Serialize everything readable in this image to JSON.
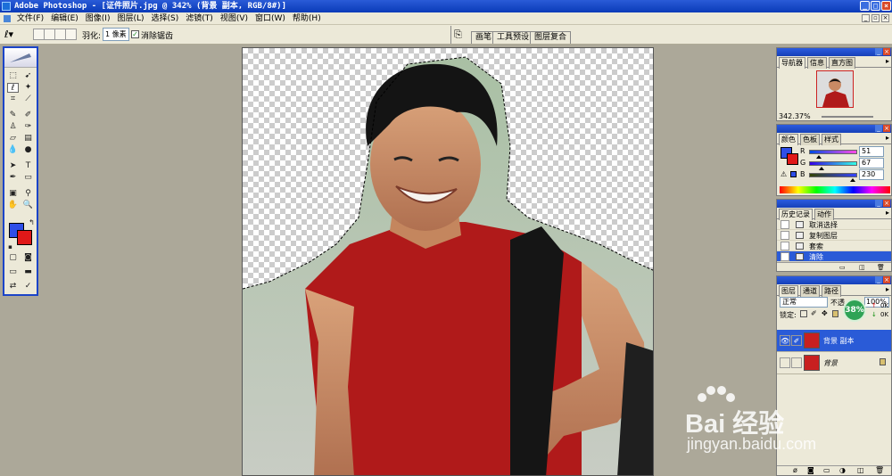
{
  "window": {
    "title": "Adobe Photoshop - [证件照片.jpg @ 342% (背景 副本, RGB/8#)]"
  },
  "menu": {
    "items": [
      "文件(F)",
      "编辑(E)",
      "图像(I)",
      "图层(L)",
      "选择(S)",
      "滤镜(T)",
      "视图(V)",
      "窗口(W)",
      "帮助(H)"
    ]
  },
  "options": {
    "feather_label": "羽化:",
    "feather_value": "1 像素",
    "antialias_checked": true,
    "antialias_label": "消除锯齿",
    "well_tabs": [
      "画笔",
      "工具预设",
      "图层复合"
    ]
  },
  "colors": {
    "foreground": "#2e4ee8",
    "background": "#e01818",
    "accent": "#1b44c8"
  },
  "navigator": {
    "tabs": [
      "导航器",
      "信息",
      "直方图"
    ],
    "zoom": "342.37%"
  },
  "color_panel": {
    "tabs": [
      "颜色",
      "色板",
      "样式"
    ],
    "r_label": "R",
    "r_value": "51",
    "r_fraction": 0.2,
    "g_label": "G",
    "g_value": "67",
    "g_fraction": 0.26,
    "b_label": "B",
    "b_value": "230",
    "b_fraction": 0.9
  },
  "history": {
    "tabs": [
      "历史记录",
      "动作"
    ],
    "items": [
      "取消选择",
      "复制图层",
      "套索",
      "清除"
    ],
    "selected_index": 3
  },
  "layers": {
    "tabs": [
      "图层",
      "通道",
      "路径"
    ],
    "blend_mode": "正常",
    "opacity_label": "不透",
    "opacity_value": "100%",
    "lock_label": "锁定:",
    "items": [
      {
        "name": "背景 副本",
        "visible": true,
        "selected": true,
        "locked": false
      },
      {
        "name": "背景",
        "visible": false,
        "selected": false,
        "locked": true
      }
    ]
  },
  "overlay_badge": {
    "value": "38%",
    "line1_a": "0K",
    "line2_a": "0K"
  },
  "watermark": {
    "brand": "Bai 经验",
    "url": "jingyan.baidu.com"
  }
}
